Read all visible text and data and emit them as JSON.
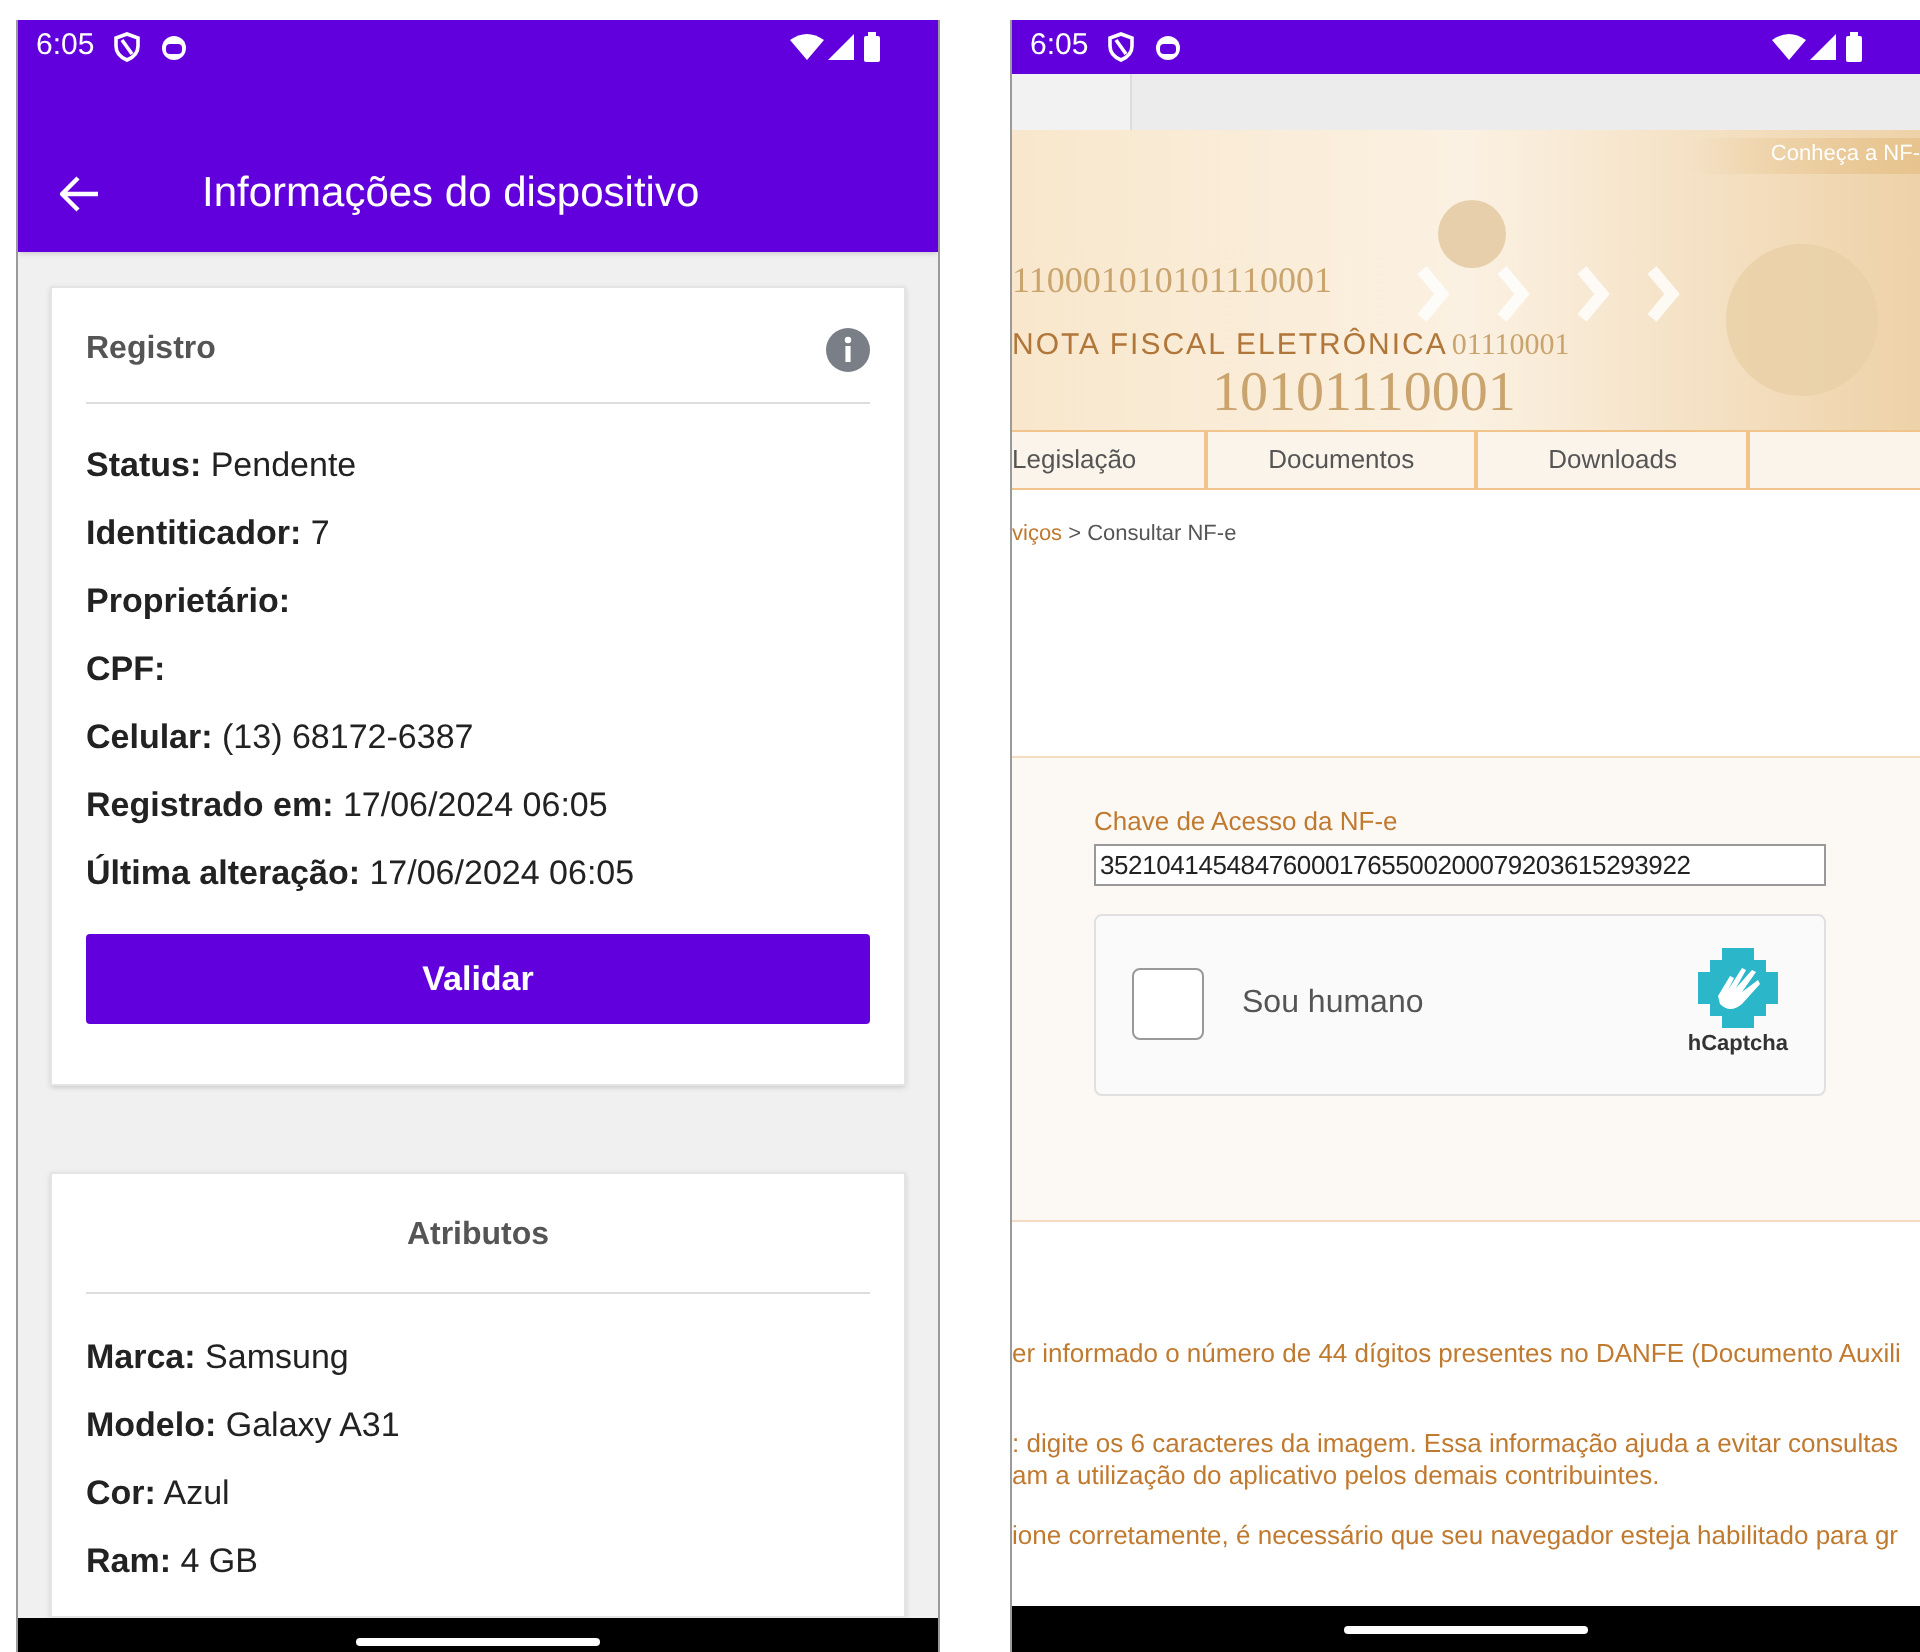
{
  "left_screen": {
    "status_bar": {
      "time": "6:05"
    },
    "app_bar": {
      "title": "Informações do dispositivo"
    },
    "registro_card": {
      "title": "Registro",
      "fields": [
        {
          "label": "Status:",
          "value": "Pendente"
        },
        {
          "label": "Identiticador:",
          "value": "7"
        },
        {
          "label": "Proprietário:"
        },
        {
          "label": "CPF:"
        },
        {
          "label": "Celular:",
          "value": "(13) 68172-6387"
        },
        {
          "label": "Registrado em:",
          "value": "17/06/2024 06:05"
        },
        {
          "label": "Última alteração:",
          "value": "17/06/2024 06:05"
        }
      ],
      "button": "Validar"
    },
    "atributos_card": {
      "title": "Atributos",
      "fields": [
        {
          "label": "Marca:",
          "value": "Samsung"
        },
        {
          "label": "Modelo:",
          "value": "Galaxy A31"
        },
        {
          "label": "Cor:",
          "value": "Azul"
        },
        {
          "label": "Ram:",
          "value": "4 GB"
        }
      ]
    }
  },
  "right_screen": {
    "status_bar": {
      "time": "6:05"
    },
    "banner": {
      "link": "Conheça a NF-",
      "title": "NOTA FISCAL ELETRÔNICA",
      "digits": [
        "110001010101110001",
        "01110001",
        "10101110001"
      ]
    },
    "nav_tabs": [
      {
        "label": "Legislação"
      },
      {
        "label": "Documentos"
      },
      {
        "label": "Downloads"
      }
    ],
    "breadcrumb": {
      "link": "viços",
      "current": "> Consultar NF-e"
    },
    "form": {
      "label": "Chave de Acesso da NF-e",
      "value": "352104145484760001765500200079203615293922",
      "captcha": {
        "checked": false,
        "label": "Sou humano",
        "brand": "hCaptcha"
      }
    },
    "notes": [
      "er informado o número de 44 dígitos presentes no DANFE (Documento Auxili",
      ": digite os 6 caracteres da imagem. Essa informação ajuda a evitar consultas\nam a utilização do aplicativo pelos demais contribuintes.",
      "ione corretamente, é necessário que seu navegador esteja habilitado para gr"
    ]
  }
}
